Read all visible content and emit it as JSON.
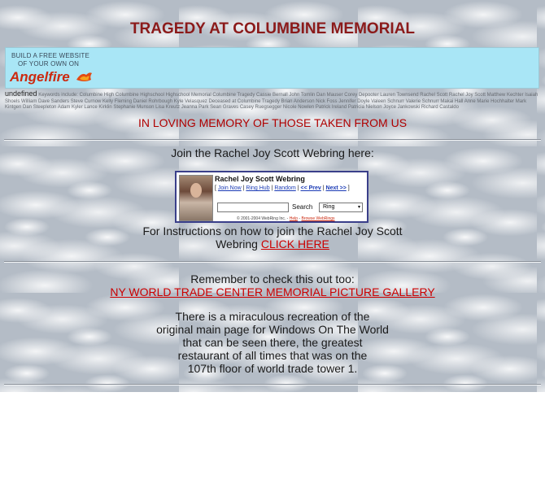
{
  "page": {
    "title": "TRAGEDY AT COLUMBINE MEMORIAL",
    "colors": {
      "title": "#8b1a1a",
      "link": "#cc0000",
      "banner_bg": "#a9e6f6"
    }
  },
  "ad": {
    "line1": "BUILD A FREE WEBSITE",
    "line2": "OF YOUR OWN ON",
    "brand": "Angelfire"
  },
  "keywords": {
    "undefined_label": "undefined",
    "text": "Keywords include: Columbine High Columbine Highschool Highschool Memorial Columbine Tragedy Cassie Bernall John Tomlin Dan Mauser Corey Depooter Lauren Townsend Rachel Scott Rachel Joy Scott Matthew Kechter Isaiah Shoels William Dave Sanders Steve Curnow Kelly Fleming Daniel Rohrbough Kyle Velasquez Deceased at Columbine Tragedy Brian Anderson Nick Foss Jennifer Doyle Valeen Schnurr Valerie Schnurr Makai Hall Anne Marie Hochhalter Mark Kintgen Dan Steepleton Adam Kyler Lance Kirklin Stephanie Munson Lisa Kreutz Jeanna Park Sean Graves Casey Ruegsegger Nicole Nowlen Patrick Ireland Patricia Nielson Joyce Jankowski Richard Castaldo"
  },
  "memory_heading": "IN LOVING MEMORY OF THOSE TAKEN FROM US",
  "webring_intro": "Join the Rachel Joy Scott Webring here:",
  "webring": {
    "title": "Rachel Joy Scott Webring",
    "open_bracket": "[ ",
    "join": "Join Now",
    "hub": "Ring Hub",
    "random": "Random",
    "prev": "<< Prev",
    "next": "Next >>",
    "sep": " | ",
    "close_bracket": " ]",
    "search_button": "Search",
    "select_value": "Ring",
    "copyright": "© 2001-2004 WebRing Inc. - ",
    "help": "Help",
    "dash": " - ",
    "browse": "Browse WebRings"
  },
  "instructions": {
    "line1": "For Instructions on how to join the Rachel Joy Scott",
    "line2_prefix": "Webring ",
    "link": "CLICK HERE"
  },
  "reminder": {
    "line": "Remember to check this out too:",
    "link": "NY WORLD TRADE CENTER MEMORIAL PICTURE GALLERY"
  },
  "paragraph": [
    "There is a miraculous recreation of the",
    "original main page for Windows On The World",
    "that can be seen there, the greatest",
    "restaurant of all times that was on the",
    "107th floor of world trade tower 1."
  ]
}
